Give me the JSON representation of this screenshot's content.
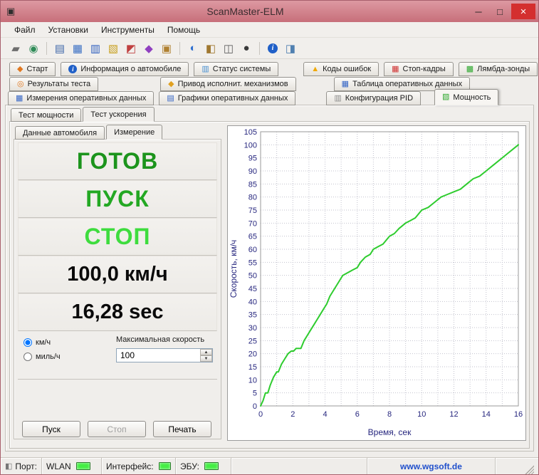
{
  "window": {
    "title": "ScanMaster-ELM",
    "icon_glyph": "▣",
    "minimize": "─",
    "maximize": "□",
    "close": "×"
  },
  "menu": {
    "items": [
      "Файл",
      "Установки",
      "Инструменты",
      "Помощь"
    ]
  },
  "toolbar": {
    "icons": [
      {
        "name": "plug-icon",
        "glyph": "▰",
        "color": "#6E6E6E"
      },
      {
        "name": "globe-icon",
        "glyph": "◉",
        "color": "#2E8B57"
      },
      {
        "name": "doc-icon",
        "glyph": "▤",
        "color": "#4169AA"
      },
      {
        "name": "table-icon",
        "glyph": "▦",
        "color": "#3A6FC4"
      },
      {
        "name": "monitor-icon",
        "glyph": "▥",
        "color": "#2F5FBF"
      },
      {
        "name": "report-icon",
        "glyph": "▧",
        "color": "#C8A020"
      },
      {
        "name": "chart-icon",
        "glyph": "◩",
        "color": "#C04040"
      },
      {
        "name": "gauge-icon",
        "glyph": "◆",
        "color": "#9040C0"
      },
      {
        "name": "note-icon",
        "glyph": "▣",
        "color": "#B08030"
      },
      {
        "name": "chat-icon",
        "glyph": "◐",
        "color": "#3070D0"
      },
      {
        "name": "tools-icon",
        "glyph": "◧",
        "color": "#A07830"
      },
      {
        "name": "device-icon",
        "glyph": "◫",
        "color": "#606060"
      },
      {
        "name": "disc-icon",
        "glyph": "●",
        "color": "#3A3A3A"
      },
      {
        "name": "info-icon",
        "glyph": "i",
        "color": "#2060C8"
      },
      {
        "name": "module-icon",
        "glyph": "◨",
        "color": "#5080B0"
      }
    ]
  },
  "tabs": {
    "row1": [
      {
        "label": "Старт",
        "icon_glyph": "◆",
        "icon_color": "#E07820"
      },
      {
        "label": "Информация о автомобиле",
        "icon_glyph": "i",
        "icon_color": "#1E64C8"
      },
      {
        "label": "Статус системы",
        "icon_glyph": "▥",
        "icon_color": "#4A90D0"
      },
      {
        "label": "Коды ошибок",
        "icon_glyph": "▲",
        "icon_color": "#F0A800"
      },
      {
        "label": "Стоп-кадры",
        "icon_glyph": "▦",
        "icon_color": "#D03030"
      },
      {
        "label": "Лямбда-зонды",
        "icon_glyph": "▩",
        "icon_color": "#2FA82F"
      }
    ],
    "row2": [
      {
        "label": "Результаты теста",
        "icon_glyph": "◎",
        "icon_color": "#E07820"
      },
      {
        "label": "Привод исполнит. механизмов",
        "icon_glyph": "◆",
        "icon_color": "#E0A020"
      },
      {
        "label": "Таблица оперативных данных",
        "icon_glyph": "▦",
        "icon_color": "#3565C5"
      }
    ],
    "row3": [
      {
        "label": "Измерения оперативных данных",
        "icon_glyph": "▦",
        "icon_color": "#3565C5"
      },
      {
        "label": "Графики оперативных данных",
        "icon_glyph": "▤",
        "icon_color": "#3565C5"
      },
      {
        "label": "Конфигурация PID",
        "icon_glyph": "▥",
        "icon_color": "#8A8A8A"
      },
      {
        "label": "Мощность",
        "icon_glyph": "▧",
        "icon_color": "#2FA82F",
        "active": true
      }
    ]
  },
  "subtabs": {
    "items": [
      {
        "label": "Тест мощности"
      },
      {
        "label": "Тест ускорения",
        "active": true
      }
    ]
  },
  "innertabs": {
    "items": [
      {
        "label": "Данные автомобиля"
      },
      {
        "label": "Измерение",
        "active": true
      }
    ]
  },
  "panel": {
    "ready": "ГОТОВ",
    "ready_color": "#1C941C",
    "start": "ПУСК",
    "start_color": "#23A823",
    "stop": "СТОП",
    "stop_color": "#3EDC3E",
    "speed": "100,0 км/ч",
    "time": "16,28 sec",
    "value_color": "#0A0A0A",
    "units": [
      {
        "label": "км/ч",
        "selected": true
      },
      {
        "label": "миль/ч",
        "selected": false
      }
    ],
    "max_speed_label": "Максимальная скорость",
    "max_speed_value": "100",
    "buttons": {
      "start": "Пуск",
      "stop": "Стоп",
      "stop_disabled": true,
      "print": "Печать"
    }
  },
  "chart_data": {
    "type": "line",
    "title": "",
    "xlabel": "Время, сек",
    "ylabel": "Скорость, км/ч",
    "xlim": [
      0,
      16
    ],
    "ylim": [
      0,
      105
    ],
    "xticks": [
      0,
      2,
      4,
      6,
      8,
      10,
      12,
      14,
      16
    ],
    "yticks": [
      0,
      5,
      10,
      15,
      20,
      25,
      30,
      35,
      40,
      45,
      50,
      55,
      60,
      65,
      70,
      75,
      80,
      85,
      90,
      95,
      100,
      105
    ],
    "xgrid_step": 1,
    "ygrid_step": 5,
    "grid": "dotted",
    "grid_color": "#C2C2CE",
    "axis_color": "#26267E",
    "tick_color": "#26267E",
    "plot_border_color": "#9A9A9A",
    "background": "#FFFFFF",
    "legend": "none",
    "series": [
      {
        "name": "Скорость",
        "color": "#2ECC2E",
        "x": [
          0,
          0.15,
          0.3,
          0.45,
          0.6,
          0.8,
          1.0,
          1.1,
          1.3,
          1.5,
          1.7,
          1.9,
          2.05,
          2.2,
          2.5,
          2.7,
          2.9,
          3.1,
          3.3,
          3.5,
          3.7,
          3.9,
          4.1,
          4.3,
          4.6,
          4.9,
          5.1,
          5.4,
          5.7,
          6.0,
          6.2,
          6.5,
          6.8,
          7.0,
          7.3,
          7.6,
          8.0,
          8.3,
          8.6,
          9.0,
          9.3,
          9.6,
          10.0,
          10.4,
          10.8,
          11.2,
          11.6,
          12.0,
          12.4,
          12.8,
          13.2,
          13.6,
          14.0,
          14.4,
          14.8,
          15.2,
          15.6,
          16.0
        ],
        "y": [
          0,
          2,
          5,
          5,
          8,
          11,
          13,
          13,
          16,
          18,
          20,
          21,
          21,
          22,
          22,
          25,
          27,
          29,
          31,
          33,
          35,
          37,
          39,
          42,
          45,
          48,
          50,
          51,
          52,
          53,
          55,
          57,
          58,
          60,
          61,
          62,
          65,
          66,
          68,
          70,
          71,
          72,
          75,
          76,
          78,
          80,
          81,
          82,
          83,
          85,
          87,
          88,
          90,
          92,
          94,
          96,
          98,
          100
        ]
      }
    ]
  },
  "statusbar": {
    "port_label": "Порт:",
    "wlan_label": "WLAN",
    "interface_label": "Интерфейс:",
    "ecu_label": "ЭБУ:",
    "url": "www.wgsoft.de",
    "led_color": "#44EE44",
    "link_color": "#1F4FCC"
  }
}
